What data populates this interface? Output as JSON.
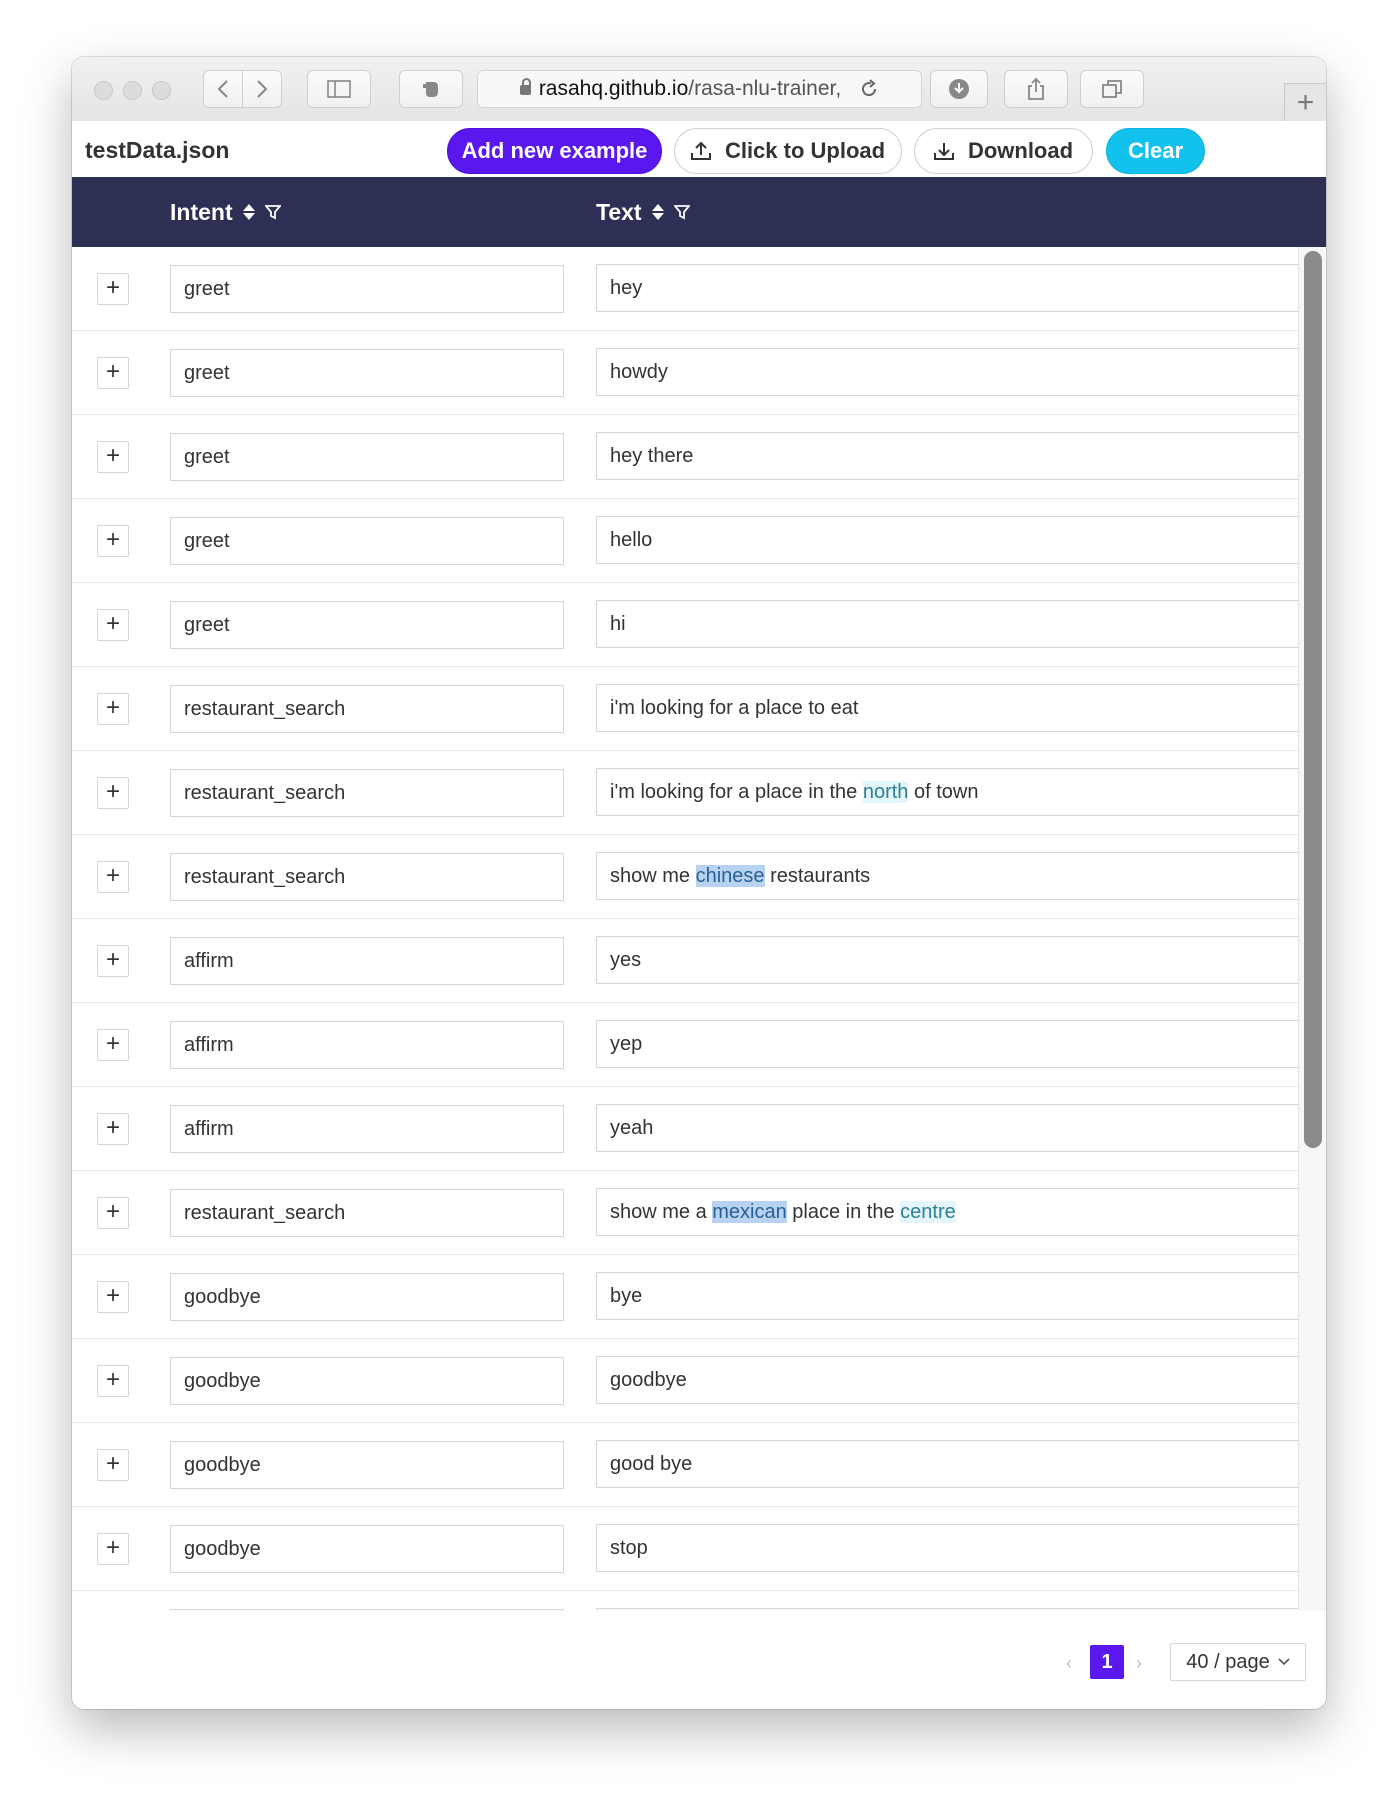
{
  "browser": {
    "url_host": "rasahq.github.io",
    "url_path": "/rasa-nlu-trainer,"
  },
  "toolbar": {
    "filename": "testData.json",
    "add_label": "Add new example",
    "upload_label": "Click to Upload",
    "download_label": "Download",
    "clear_label": "Clear"
  },
  "table": {
    "columns": [
      "Intent",
      "Text"
    ],
    "rows": [
      {
        "intent": "greet",
        "text": [
          {
            "t": "hey"
          }
        ]
      },
      {
        "intent": "greet",
        "text": [
          {
            "t": "howdy"
          }
        ]
      },
      {
        "intent": "greet",
        "text": [
          {
            "t": "hey there"
          }
        ]
      },
      {
        "intent": "greet",
        "text": [
          {
            "t": "hello"
          }
        ]
      },
      {
        "intent": "greet",
        "text": [
          {
            "t": "hi"
          }
        ]
      },
      {
        "intent": "restaurant_search",
        "text": [
          {
            "t": "i'm looking for a place to eat"
          }
        ]
      },
      {
        "intent": "restaurant_search",
        "text": [
          {
            "t": "i'm looking for a place in the "
          },
          {
            "t": "north",
            "ent": "a"
          },
          {
            "t": " of town"
          }
        ]
      },
      {
        "intent": "restaurant_search",
        "text": [
          {
            "t": "show me "
          },
          {
            "t": "chinese",
            "ent": "b"
          },
          {
            "t": " restaurants"
          }
        ]
      },
      {
        "intent": "affirm",
        "text": [
          {
            "t": "yes"
          }
        ]
      },
      {
        "intent": "affirm",
        "text": [
          {
            "t": "yep"
          }
        ]
      },
      {
        "intent": "affirm",
        "text": [
          {
            "t": "yeah"
          }
        ]
      },
      {
        "intent": "restaurant_search",
        "text": [
          {
            "t": "show me a "
          },
          {
            "t": "mexican",
            "ent": "b"
          },
          {
            "t": " place in the "
          },
          {
            "t": "centre",
            "ent": "a"
          }
        ]
      },
      {
        "intent": "goodbye",
        "text": [
          {
            "t": "bye"
          }
        ]
      },
      {
        "intent": "goodbye",
        "text": [
          {
            "t": "goodbye"
          }
        ]
      },
      {
        "intent": "goodbye",
        "text": [
          {
            "t": "good bye"
          }
        ]
      },
      {
        "intent": "goodbye",
        "text": [
          {
            "t": "stop"
          }
        ]
      },
      {
        "intent": "",
        "text": [
          {
            "t": ""
          }
        ]
      }
    ],
    "expand_symbol": "+"
  },
  "pagination": {
    "current_page": "1",
    "page_size": "40 / page"
  },
  "colors": {
    "header_bg": "#2d2f54",
    "primary": "#5a17ee",
    "clear": "#12c1ec",
    "entity_light": "#e3f6fb",
    "entity_dark": "#b8d3f1"
  }
}
